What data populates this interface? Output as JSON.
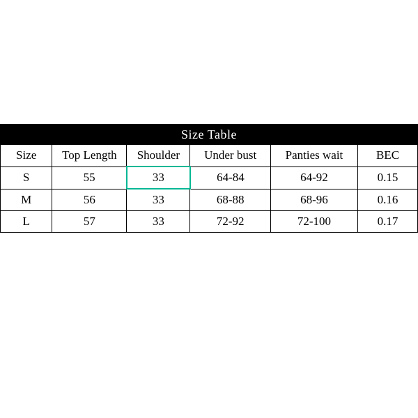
{
  "chart_data": {
    "type": "table",
    "title": "Size Table",
    "columns": [
      "Size",
      "Top Length",
      "Shoulder",
      "Under bust",
      "Panties wait",
      "BEC"
    ],
    "rows": [
      {
        "size": "S",
        "top_length": "55",
        "shoulder": "33",
        "under_bust": "64-84",
        "panties_wait": "64-92",
        "bec": "0.15"
      },
      {
        "size": "M",
        "top_length": "56",
        "shoulder": "33",
        "under_bust": "68-88",
        "panties_wait": "68-96",
        "bec": "0.16"
      },
      {
        "size": "L",
        "top_length": "57",
        "shoulder": "33",
        "under_bust": "72-92",
        "panties_wait": "72-100",
        "bec": "0.17"
      }
    ],
    "highlighted_cell": {
      "row": 0,
      "col": "shoulder"
    },
    "highlight_color": "#00b894"
  }
}
